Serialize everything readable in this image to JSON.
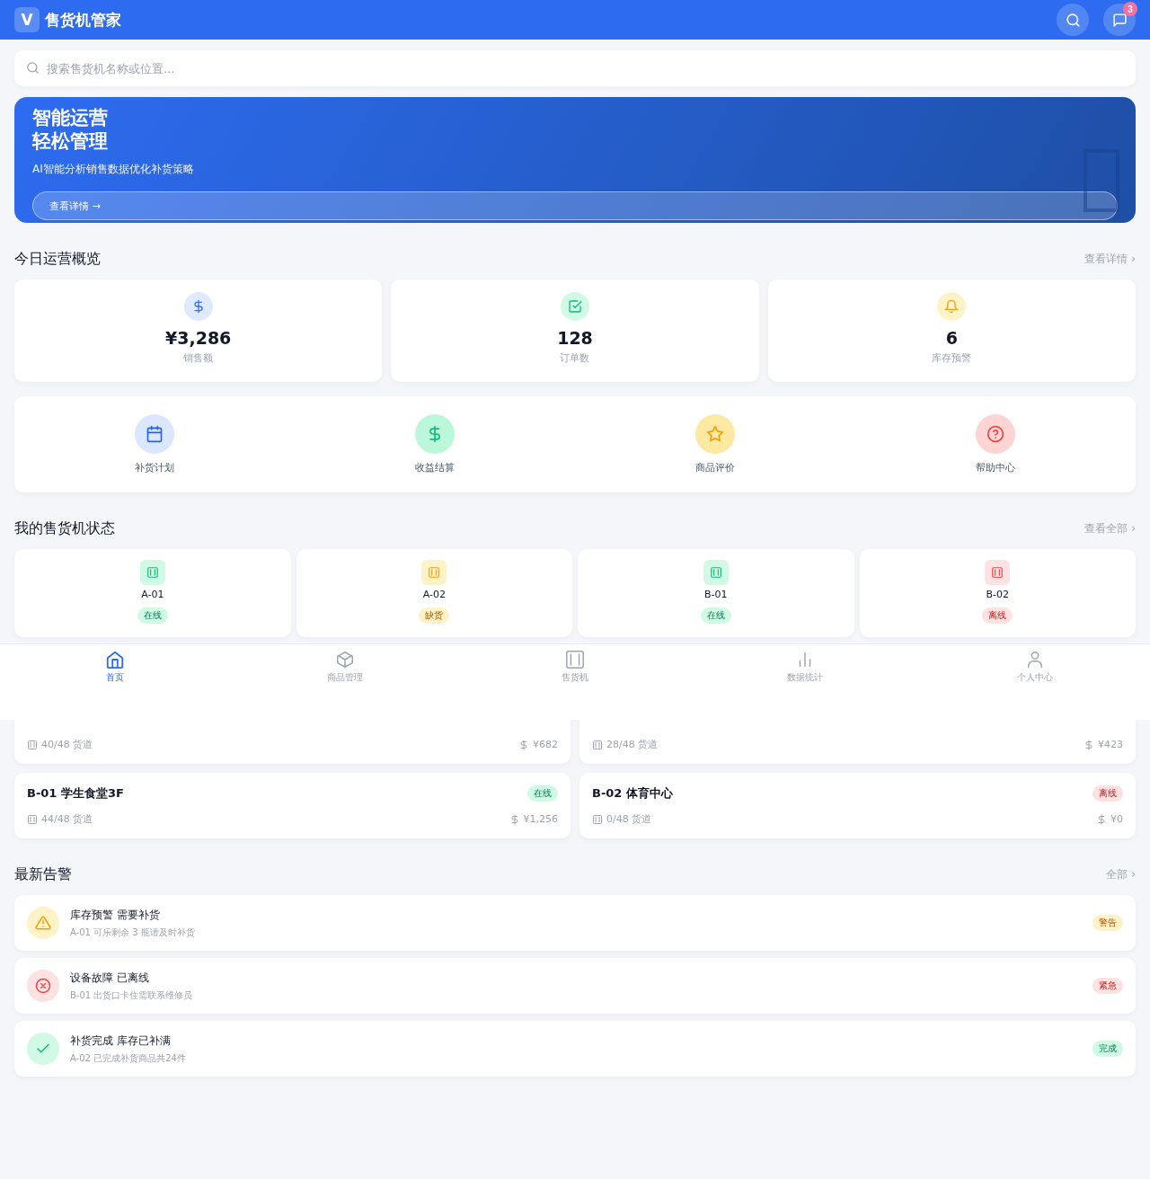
{
  "header": {
    "logo": "V",
    "title": "售货机管家",
    "message_count": "3"
  },
  "search": {
    "placeholder": "搜索售货机名称或位置..."
  },
  "banner": {
    "title_lines": [
      "智能运营",
      "轻松管理"
    ],
    "subtitle": "AI智能分析销售数据优化补货策略",
    "button": "查看详情 →"
  },
  "overview": {
    "title": "今日运营概览",
    "link": "查看详情 ›",
    "stats": [
      {
        "kind": "money",
        "value": "¥3,286",
        "label": "销售额"
      },
      {
        "kind": "orders",
        "value": "128",
        "label": "订单数"
      },
      {
        "kind": "alerts",
        "value": "6",
        "label": "库存预警"
      }
    ],
    "actions": [
      {
        "kind": "calendar",
        "label": "补货计划"
      },
      {
        "kind": "money",
        "label": "收益结算"
      },
      {
        "kind": "star",
        "label": "商品评价"
      },
      {
        "kind": "help",
        "label": "帮助中心"
      }
    ]
  },
  "machines": {
    "title": "我的售货机状态",
    "link": "查看全部 ›",
    "items": [
      {
        "code": "A-01",
        "color": "#d1fae5",
        "badge": "在线"
      },
      {
        "code": "A-02",
        "color": "#fef3c7",
        "badge": "缺货"
      },
      {
        "code": "B-01",
        "color": "#d1fae5",
        "badge": "在线"
      },
      {
        "code": "B-02",
        "color": "#fee2e2",
        "badge": "离线"
      }
    ]
  },
  "machine_details": [
    {
      "slots": "40/48 货道",
      "revenue": "¥682"
    },
    {
      "slots": "28/48 货道",
      "revenue": "¥423"
    },
    {
      "name": "B-01 学生食堂3F",
      "color": "#d1fae5",
      "badge": "在线",
      "slots": "44/48 货道",
      "revenue": "¥1,256"
    },
    {
      "name": "B-02 体育中心",
      "color": "#fee2e2",
      "badge": "离线",
      "slots": "0/48 货道",
      "revenue": "¥0"
    }
  ],
  "alerts": {
    "title": "最新告警",
    "link": "全部 ›",
    "items": [
      {
        "kind": "warning",
        "title": "库存预警 需要补货",
        "detail": "A-01 可乐剩余 3 瓶请及时补货",
        "badge": "警告"
      },
      {
        "kind": "error",
        "title": "设备故障 已离线",
        "detail": "B-01 出货口卡住需联系维修员",
        "badge": "紧急"
      },
      {
        "kind": "success",
        "title": "补货完成 库存已补满",
        "detail": "A-02 已完成补货商品共24件",
        "badge": "完成"
      }
    ]
  },
  "nav": [
    {
      "kind": "home",
      "label": "首页",
      "selected": true
    },
    {
      "kind": "box",
      "label": "商品管理",
      "selected": false
    },
    {
      "kind": "machine",
      "label": "售货机",
      "selected": false
    },
    {
      "kind": "chart",
      "label": "数据统计",
      "selected": false
    },
    {
      "kind": "user",
      "label": "个人中心",
      "selected": false
    }
  ]
}
